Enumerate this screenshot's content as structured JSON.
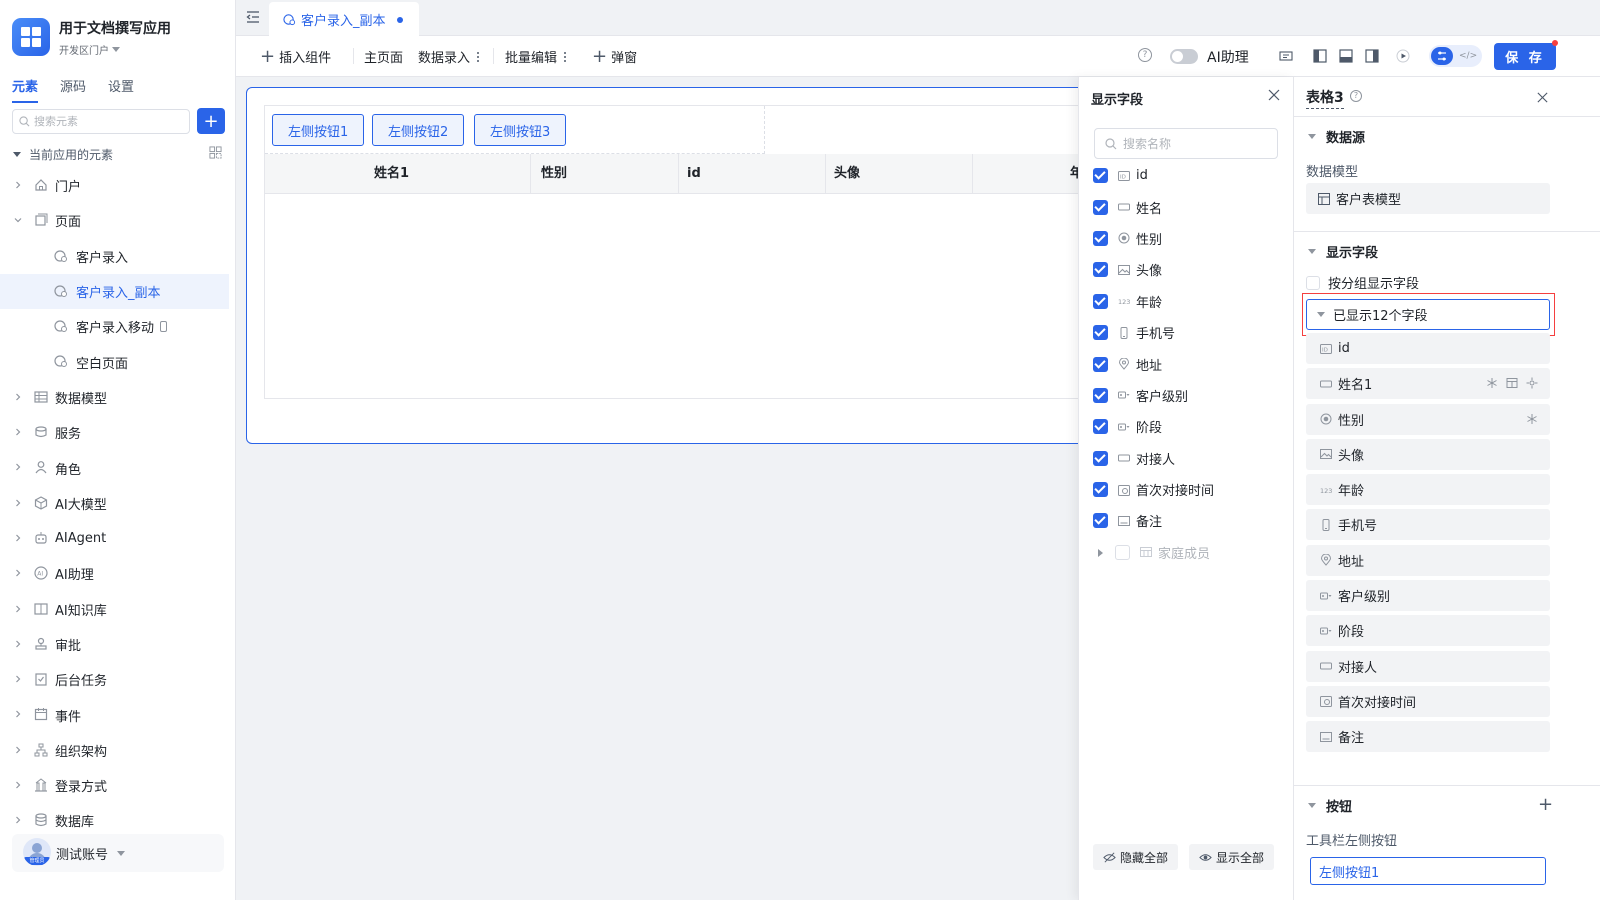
{
  "app": {
    "title": "用于文档撰写应用",
    "portal": "开发区门户"
  },
  "sidebar": {
    "tabs": [
      {
        "label": "元素",
        "active": true
      },
      {
        "label": "源码",
        "active": false
      },
      {
        "label": "设置",
        "active": false
      }
    ],
    "search_placeholder": "搜索元素",
    "tree_title": "当前应用的元素",
    "items": [
      {
        "label": "门户",
        "icon": "home-icon",
        "expandable": true
      },
      {
        "label": "页面",
        "icon": "pages-icon",
        "expandable": true,
        "expanded": true
      },
      {
        "label": "客户录入",
        "icon": "page-icon",
        "child": true
      },
      {
        "label": "客户录入_副本",
        "icon": "page-icon",
        "child": true,
        "selected": true
      },
      {
        "label": "客户录入移动",
        "icon": "page-icon",
        "child": true,
        "mobile": true
      },
      {
        "label": "空白页面",
        "icon": "page-icon",
        "child": true
      },
      {
        "label": "数据模型",
        "icon": "table-icon",
        "expandable": true
      },
      {
        "label": "服务",
        "icon": "service-icon",
        "expandable": true
      },
      {
        "label": "角色",
        "icon": "role-icon",
        "expandable": true
      },
      {
        "label": "AI大模型",
        "icon": "model-icon",
        "expandable": true
      },
      {
        "label": "AIAgent",
        "icon": "robot-icon",
        "expandable": true
      },
      {
        "label": "AI助理",
        "icon": "ai-icon",
        "expandable": true
      },
      {
        "label": "AI知识库",
        "icon": "book-icon",
        "expandable": true
      },
      {
        "label": "审批",
        "icon": "stamp-icon",
        "expandable": true
      },
      {
        "label": "后台任务",
        "icon": "task-icon",
        "expandable": true
      },
      {
        "label": "事件",
        "icon": "event-icon",
        "expandable": true
      },
      {
        "label": "组织架构",
        "icon": "org-icon",
        "expandable": true
      },
      {
        "label": "登录方式",
        "icon": "login-icon",
        "expandable": true
      },
      {
        "label": "数据库",
        "icon": "database-icon",
        "expandable": true
      }
    ],
    "account": {
      "name": "测试账号",
      "role_tag": "管理员"
    }
  },
  "tabbar": {
    "tab_label": "客户录入_副本"
  },
  "toolbar": {
    "insert_label": "插入组件",
    "main_page": "主页面",
    "data_entry": "数据录入",
    "batch_edit": "批量编辑",
    "popup": "弹窗",
    "ai_assistant": "AI助理",
    "save_label": "保 存"
  },
  "canvas": {
    "left_buttons": [
      "左侧按钮1",
      "左侧按钮2",
      "左侧按钮3"
    ],
    "columns": [
      "姓名1",
      "性别",
      "id",
      "头像",
      "年"
    ]
  },
  "field_panel": {
    "title": "显示字段",
    "search_placeholder": "搜索名称",
    "fields": [
      {
        "label": "id",
        "icon": "id-icon",
        "checked": true
      },
      {
        "label": "姓名",
        "icon": "text-field-icon",
        "checked": true
      },
      {
        "label": "性别",
        "icon": "radio-icon",
        "checked": true
      },
      {
        "label": "头像",
        "icon": "image-icon",
        "checked": true
      },
      {
        "label": "年龄",
        "icon": "number-icon",
        "checked": true
      },
      {
        "label": "手机号",
        "icon": "phone-icon",
        "checked": true
      },
      {
        "label": "地址",
        "icon": "location-icon",
        "checked": true
      },
      {
        "label": "客户级别",
        "icon": "select-icon",
        "checked": true
      },
      {
        "label": "阶段",
        "icon": "select-icon",
        "checked": true
      },
      {
        "label": "对接人",
        "icon": "text-field-icon",
        "checked": true
      },
      {
        "label": "首次对接时间",
        "icon": "datetime-icon",
        "checked": true
      },
      {
        "label": "备注",
        "icon": "textarea-icon",
        "checked": true
      }
    ],
    "sub_table": {
      "label": "家庭成员",
      "checked": false
    },
    "hide_all": "隐藏全部",
    "show_all": "显示全部"
  },
  "props": {
    "title": "表格3",
    "datasource_section": "数据源",
    "data_model_label": "数据模型",
    "data_model_value": "客户表模型",
    "display_section": "显示字段",
    "group_by_label": "按分组显示字段",
    "shown_count_label": "已显示12个字段",
    "fields": [
      {
        "label": "id",
        "icon": "id-icon"
      },
      {
        "label": "姓名1",
        "icon": "text-field-icon",
        "actions": [
          "freeze-icon",
          "layout-icon",
          "settings-icon"
        ]
      },
      {
        "label": "性别",
        "icon": "radio-icon",
        "actions": [
          "freeze-icon"
        ]
      },
      {
        "label": "头像",
        "icon": "image-icon"
      },
      {
        "label": "年龄",
        "icon": "number-icon"
      },
      {
        "label": "手机号",
        "icon": "phone-icon"
      },
      {
        "label": "地址",
        "icon": "location-icon"
      },
      {
        "label": "客户级别",
        "icon": "select-icon"
      },
      {
        "label": "阶段",
        "icon": "select-icon"
      },
      {
        "label": "对接人",
        "icon": "text-field-icon"
      },
      {
        "label": "首次对接时间",
        "icon": "datetime-icon"
      },
      {
        "label": "备注",
        "icon": "textarea-icon"
      }
    ],
    "button_section": "按钮",
    "toolbar_left_label": "工具栏左侧按钮",
    "toolbar_left_value": "左侧按钮1"
  },
  "colors": {
    "accent": "#2a64e8",
    "highlight": "#f53f3f"
  }
}
